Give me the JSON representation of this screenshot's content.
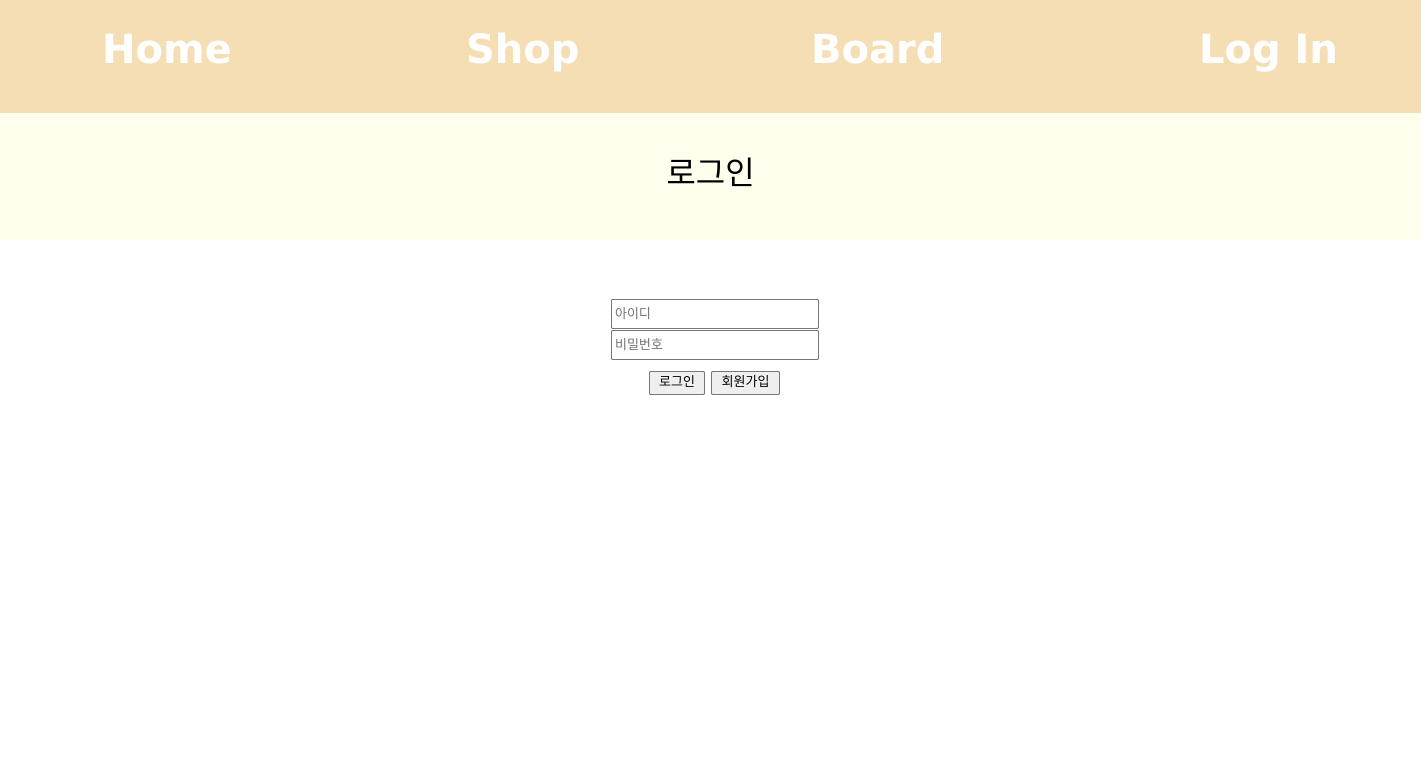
{
  "nav": {
    "home": "Home",
    "shop": "Shop",
    "board": "Board",
    "login": "Log In"
  },
  "colors": {
    "nav_background": "#f5deb3",
    "nav_text": "#ffffff",
    "title_band_background": "#ffffee"
  },
  "page": {
    "title": "로그인"
  },
  "form": {
    "id_placeholder": "아이디",
    "password_placeholder": "비밀번호",
    "login_button": "로그인",
    "signup_button": "회원가입"
  }
}
